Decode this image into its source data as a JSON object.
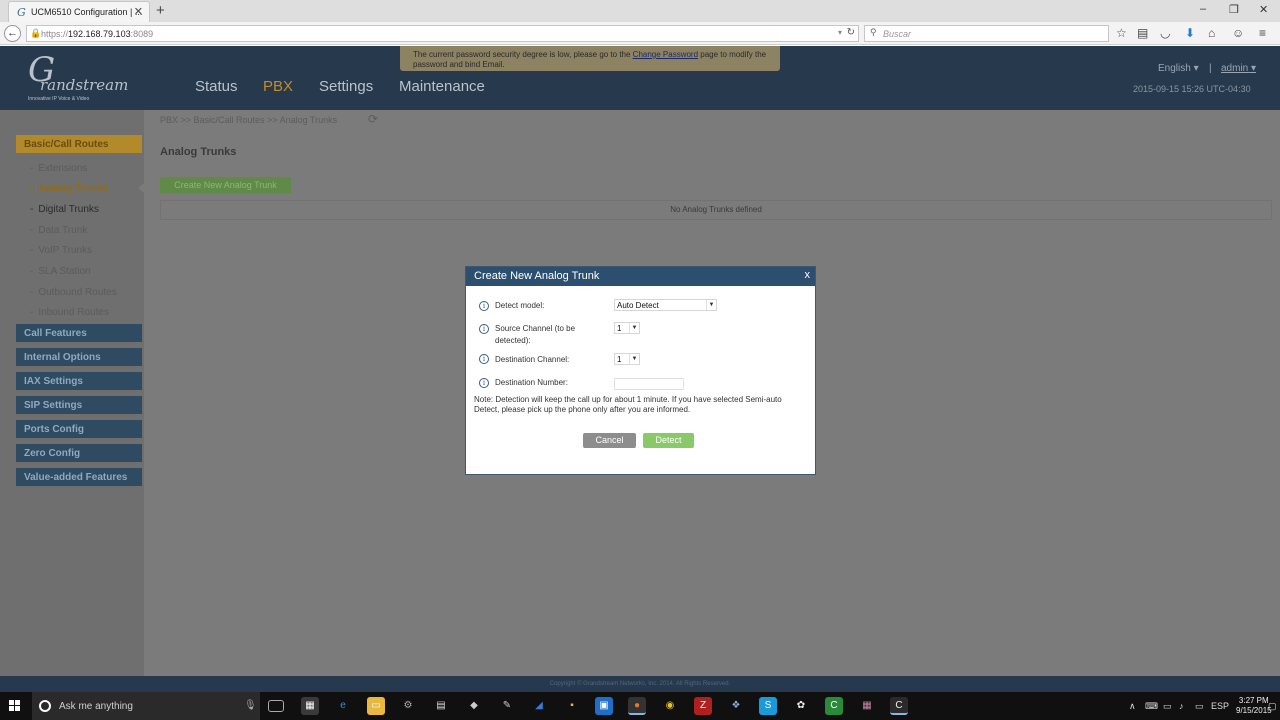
{
  "browser": {
    "tab_title": "UCM6510 Configuration | ...",
    "tab_favicon": "G",
    "url_scheme": "https://",
    "url_host": "192.168.79.103",
    "url_port": ":8089",
    "search_placeholder": "Buscar",
    "toolbar_icons": [
      "star-icon",
      "reading-list-icon",
      "pocket-icon",
      "download-icon",
      "home-icon",
      "chat-icon",
      "menu-icon"
    ]
  },
  "header": {
    "logo": {
      "letter": "G",
      "word": "randstream",
      "tagline": "Innovative IP Voice & Video"
    },
    "nav": [
      "Status",
      "PBX",
      "Settings",
      "Maintenance"
    ],
    "active_nav": "PBX",
    "notice": {
      "before_link": "The current password security degree is low, please go to the ",
      "link": "Change Password",
      "after_link": " page to modify the password and bind Email."
    },
    "language": "English",
    "separator": "|",
    "user": "admin",
    "datetime": "2015-09-15 15:26 UTC-04:30"
  },
  "sidebar": {
    "sections": [
      {
        "label": "Basic/Call Routes",
        "active": true
      },
      {
        "label": "Call Features"
      },
      {
        "label": "Internal Options"
      },
      {
        "label": "IAX Settings"
      },
      {
        "label": "SIP Settings"
      },
      {
        "label": "Ports Config"
      },
      {
        "label": "Zero Config"
      },
      {
        "label": "Value-added Features"
      }
    ],
    "sub_items": [
      "Extensions",
      "Analog Trunks",
      "Digital Trunks",
      "Data Trunk",
      "VoIP Trunks",
      "SLA Station",
      "Outbound Routes",
      "Inbound Routes"
    ],
    "selected_sub": "Analog Trunks"
  },
  "content": {
    "breadcrumb": "PBX >> Basic/Call Routes >> Analog Trunks",
    "title": "Analog Trunks",
    "create_button": "Create New Analog Trunk",
    "empty_message": "No Analog Trunks defined"
  },
  "dialog": {
    "title": "Create New Analog Trunk",
    "close": "x",
    "fields": {
      "detect_model_label": "Detect model:",
      "detect_model_value": "Auto Detect",
      "source_channel_label_1": "Source Channel (to be",
      "source_channel_label_2": "detected):",
      "source_channel_value": "1",
      "destination_channel_label": "Destination Channel:",
      "destination_channel_value": "1",
      "destination_number_label": "Destination Number:",
      "destination_number_value": ""
    },
    "note": "Note: Detection will keep the call up for about 1 minute. If you have selected Semi-auto Detect, please pick up the phone only after you are informed.",
    "cancel_button": "Cancel",
    "detect_button": "Detect"
  },
  "footer": {
    "copyright": "Copyright © Grandstream Networks, Inc. 2014. All Rights Reserved."
  },
  "taskbar": {
    "search_placeholder": "Ask me anything",
    "clock_time": "3:27 PM",
    "clock_date": "9/15/2015",
    "language": "ESP"
  },
  "colors": {
    "header_bg": "#26394d",
    "active_accent": "#c58a2a",
    "dialog_title_bg": "#2c4f70",
    "detect_green": "#89c96a"
  }
}
